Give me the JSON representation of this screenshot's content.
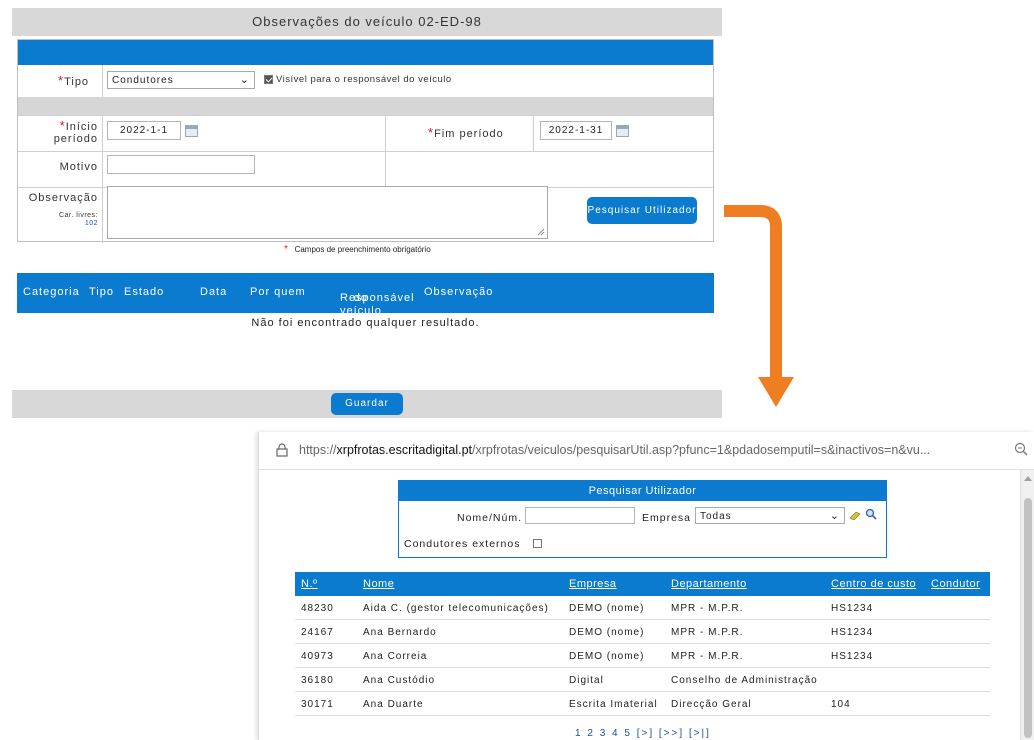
{
  "form": {
    "title": "Observações do veículo 02-ED-98",
    "tipo_label": "Tipo",
    "tipo_value": "Condutores",
    "visible_label": "Visível para o responsável do veículo",
    "inicio_label_1": "Início",
    "inicio_label_2": "período",
    "inicio_value": "2022-1-1",
    "fim_label": "Fim período",
    "fim_value": "2022-1-31",
    "motivo_label": "Motivo",
    "motivo_value": "",
    "observacao_label": "Observação",
    "car_livres_label": "Car. livres:",
    "car_livres_value": "102",
    "search_user_button": "Pesquisar Utilizador",
    "required_note": "Campos de preenchimento obrigatório",
    "visible_checked": true
  },
  "results": {
    "columns": [
      "Categoria",
      "Tipo",
      "Estado",
      "Data",
      "Por quem",
      "Responsável",
      "do veículo",
      "Observação"
    ],
    "empty_message": "Não foi encontrado qualquer resultado."
  },
  "footer": {
    "save_button": "Guardar"
  },
  "popup": {
    "url_prefix": "https://",
    "url_host": "xrpfrotas.escritadigital.pt",
    "url_path": "/xrpfrotas/veiculos/pesquisarUtil.asp?pfunc=1&pdadosemputil=s&inactivos=n&vu...",
    "search_title": "Pesquisar Utilizador",
    "name_label": "Nome/Núm.",
    "name_value": "",
    "empresa_label": "Empresa",
    "empresa_value": "Todas",
    "external_label": "Condutores externos",
    "columns": [
      "N.º",
      "Nome",
      "Empresa",
      "Departamento",
      "Centro de custo",
      "Condutor"
    ],
    "rows": [
      {
        "num": "48230",
        "nome": "Aida C. (gestor telecomunicações)",
        "empresa": "DEMO (nome)",
        "departamento": "MPR - M.P.R.",
        "centro": "HS1234"
      },
      {
        "num": "24167",
        "nome": "Ana Bernardo",
        "empresa": "DEMO (nome)",
        "departamento": "MPR - M.P.R.",
        "centro": "HS1234"
      },
      {
        "num": "40973",
        "nome": "Ana Correia",
        "empresa": "DEMO (nome)",
        "departamento": "MPR - M.P.R.",
        "centro": "HS1234"
      },
      {
        "num": "36180",
        "nome": "Ana Custódio",
        "empresa": "Digital",
        "departamento": "Conselho de Administração",
        "centro": ""
      },
      {
        "num": "30171",
        "nome": "Ana Duarte",
        "empresa": "Escrita Imaterial",
        "departamento": "Direcção Geral",
        "centro": "104"
      }
    ],
    "pager": [
      "1",
      "2",
      "3",
      "4",
      "5",
      "[>]",
      "[>>]",
      "[>|]"
    ]
  },
  "colors": {
    "accent": "#0b7bd0",
    "arrow": "#ef7d22",
    "required": "#e2101c"
  },
  "icons": [
    "lock-icon",
    "zoom-icon",
    "calendar-icon",
    "chevron-down-icon",
    "eraser-icon",
    "search-icon",
    "arrow-icon"
  ]
}
